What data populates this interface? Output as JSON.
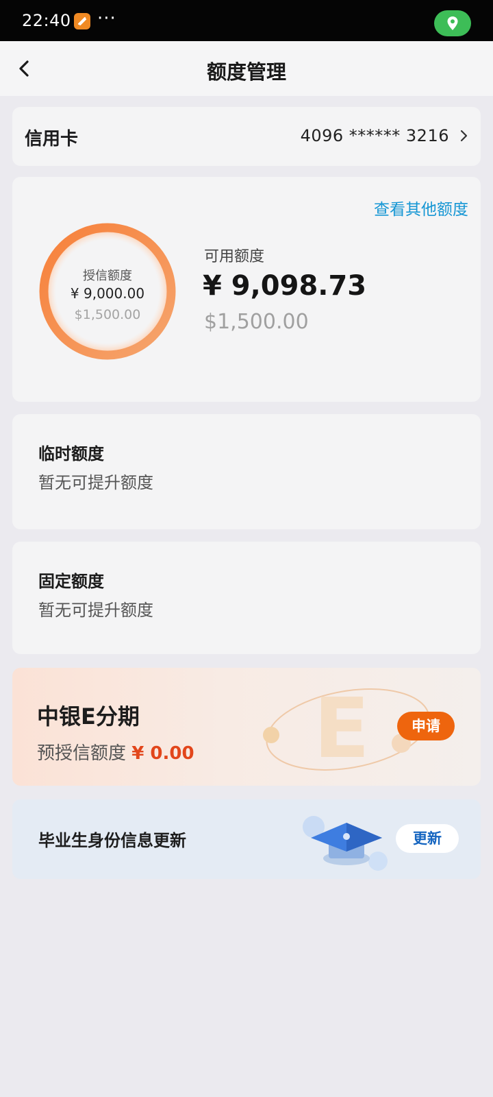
{
  "status_bar": {
    "time": "22:40",
    "more": "···",
    "app_icon": "notification-app-icon",
    "location_icon": "location-pin-icon",
    "location_color": "#3dbd57"
  },
  "nav": {
    "title": "额度管理",
    "back_icon": "chevron-left-icon"
  },
  "card_select": {
    "label": "信用卡",
    "number": "4096 ****** 3216",
    "chevron_icon": "chevron-right-icon"
  },
  "credit": {
    "other_link": "查看其他额度",
    "ring_title": "授信额度",
    "ring_cny": "¥ 9,000.00",
    "ring_usd": "$1,500.00",
    "available_label": "可用额度",
    "available_cny": "¥ 9,098.73",
    "available_usd": "$1,500.00",
    "ring_color": "#f48a3c"
  },
  "temporary_limit": {
    "title": "临时额度",
    "subtitle": "暂无可提升额度"
  },
  "fixed_limit": {
    "title": "固定额度",
    "subtitle": "暂无可提升额度"
  },
  "promo": {
    "title": "中银E分期",
    "subtitle": "预授信额度",
    "amount": "¥ 0.00",
    "apply": "申请",
    "accent": "#ee650e"
  },
  "graduate": {
    "title": "毕业生身份信息更新",
    "update": "更新",
    "icon": "graduation-cap-icon",
    "accent": "#1565c0"
  }
}
